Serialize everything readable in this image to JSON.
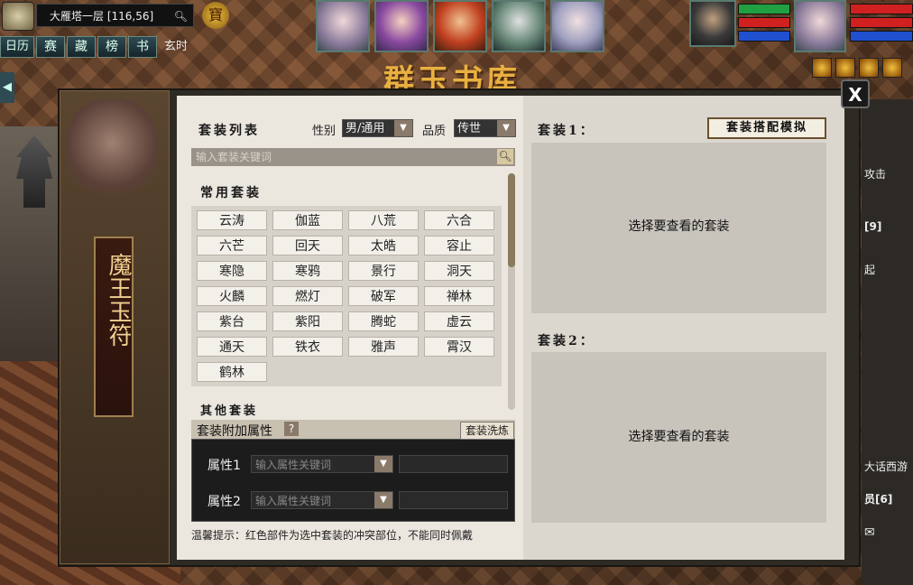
{
  "location": {
    "name": "大雁塔一层",
    "coords": "[116,56]"
  },
  "treasure_label": "寶",
  "toolbar": {
    "buttons": [
      "日历",
      "赛",
      "藏",
      "榜",
      "书"
    ],
    "mode": "玄时"
  },
  "banner": "群玉书库",
  "close_label": "X",
  "side_scroll_title": "魔王玉符",
  "suit_list": {
    "title": "套装列表",
    "gender_label": "性别",
    "gender_value": "男/通用",
    "quality_label": "品质",
    "quality_value": "传世",
    "search_placeholder": "输入套装关键词",
    "common_title": "常用套装",
    "common_suits": [
      "云涛",
      "伽蓝",
      "八荒",
      "六合",
      "六芒",
      "回天",
      "太皓",
      "容止",
      "寒隐",
      "寒鸦",
      "景行",
      "洞天",
      "火麟",
      "燃灯",
      "破军",
      "禅林",
      "紫台",
      "紫阳",
      "腾蛇",
      "虚云",
      "通天",
      "铁衣",
      "雅声",
      "霄汉",
      "鹤林"
    ],
    "other_title": "其他套装"
  },
  "attr": {
    "title": "套装附加属性",
    "help": "?",
    "wash_label": "套装洗炼",
    "rows": [
      {
        "label": "属性1",
        "placeholder": "输入属性关键词"
      },
      {
        "label": "属性2",
        "placeholder": "输入属性关键词"
      }
    ]
  },
  "tip": "温馨提示：红色部件为选中套装的冲突部位，不能同时佩戴",
  "suit1": {
    "title": "套装1：",
    "empty": "选择要查看的套装"
  },
  "suit2": {
    "title": "套装2：",
    "empty": "选择要查看的套装"
  },
  "sim_button": "套装搭配模拟",
  "chat_fragments": [
    "攻击",
    "[9]",
    "起",
    "大话西游",
    "员[6]"
  ],
  "colors": {
    "accent": "#e8b040",
    "panel_bg": "#ebe7df",
    "dark": "#1c1c1c"
  }
}
